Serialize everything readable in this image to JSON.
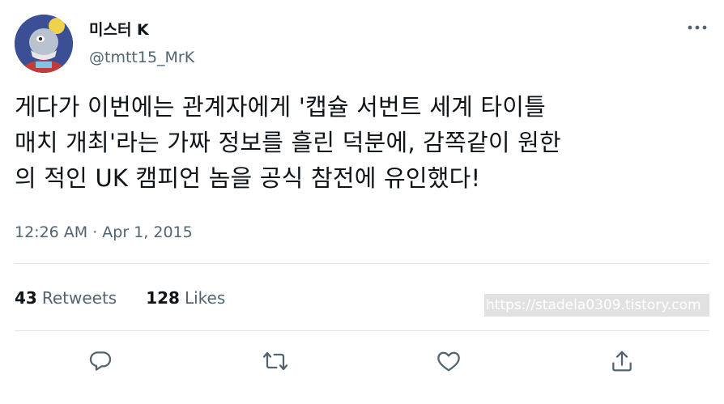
{
  "author": {
    "display_name": "미스터 K",
    "handle": "@tmtt15_MrK"
  },
  "tweet": {
    "text": "게다가 이번에는 관계자에게 '캡슐 서번트 세계 타이틀\n매치 개최'라는 가짜 정보를 흘린 덕분에, 감쪽같이 원한\n의 적인 UK 캠피언 놈을 공식 참전에 유인했다!",
    "timestamp": "12:26 AM · Apr 1, 2015"
  },
  "stats": {
    "retweets_count": "43",
    "retweets_label": "Retweets",
    "likes_count": "128",
    "likes_label": "Likes"
  },
  "watermark": "https://stadela0309.tistory.com",
  "icons": {
    "more": "more-horizontal-icon",
    "reply": "reply-icon",
    "retweet": "retweet-icon",
    "like": "like-icon",
    "share": "share-icon"
  },
  "colors": {
    "text_primary": "#0f1419",
    "text_secondary": "#536471",
    "divider": "#e1e6ea"
  }
}
